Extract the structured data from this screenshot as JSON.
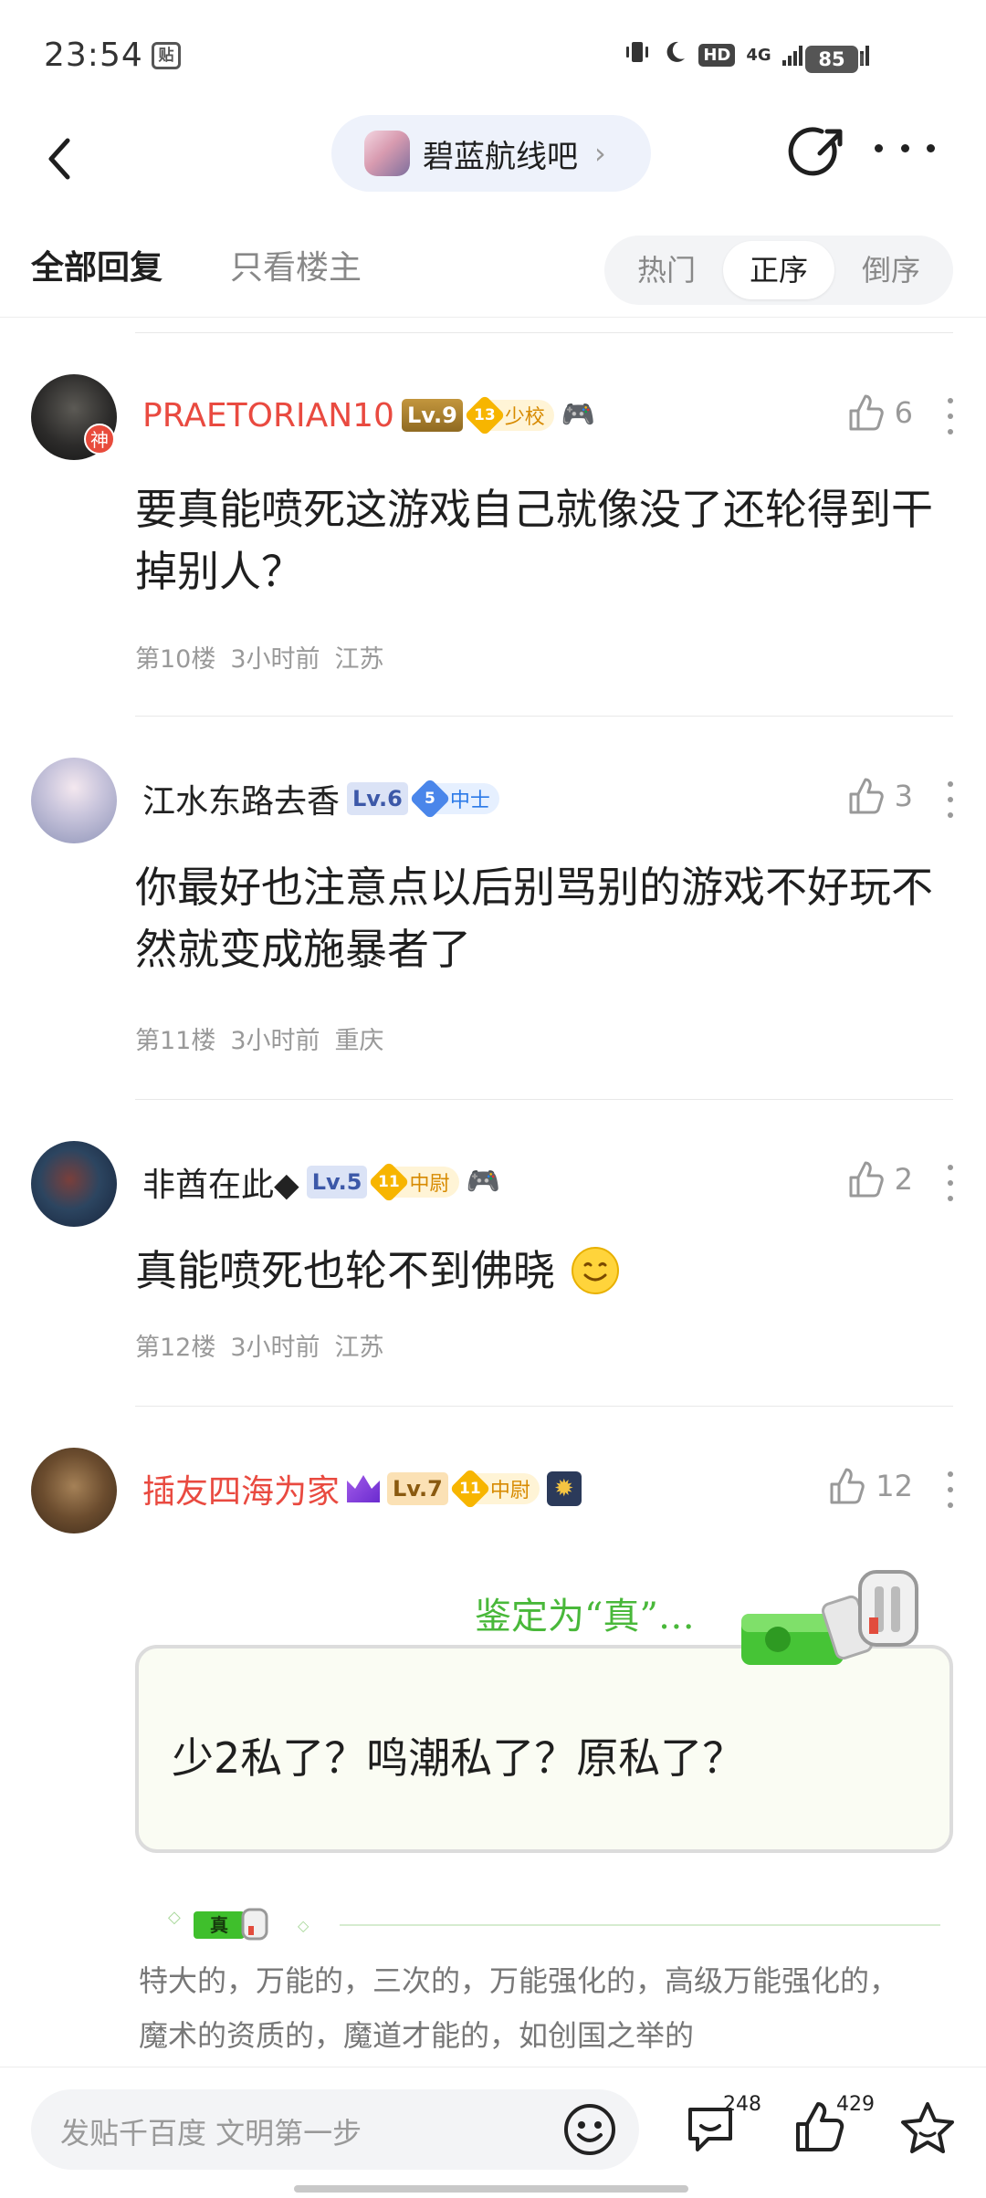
{
  "status_bar": {
    "time": "23:54",
    "app_badge": "贴",
    "hd": "HD",
    "net1": "4G",
    "net2": "4G",
    "battery": "85"
  },
  "header": {
    "forum_name": "碧蓝航线吧",
    "forum_chevron": "›"
  },
  "tabs": {
    "all": "全部回复",
    "lz": "只看楼主",
    "sort": {
      "hot": "热门",
      "asc": "正序",
      "desc": "倒序",
      "selected": "正序"
    }
  },
  "posts": [
    {
      "username": "PRAETORIAN10",
      "level": "Lv.9",
      "rank_num": "13",
      "rank_title": "少校",
      "god_badge": "神",
      "likes": "6",
      "content": "要真能喷死这游戏自己就像没了还轮得到干掉别人？",
      "floor": "第10楼",
      "time": "3小时前",
      "location": "江苏"
    },
    {
      "username": "江水东路去香",
      "level": "Lv.6",
      "rank_num": "5",
      "rank_title": "中士",
      "likes": "3",
      "content": "你最好也注意点以后别骂别的游戏不好玩不然就变成施暴者了",
      "floor": "第11楼",
      "time": "3小时前",
      "location": "重庆"
    },
    {
      "username": "非酋在此◆",
      "level": "Lv.5",
      "rank_num": "11",
      "rank_title": "中尉",
      "likes": "2",
      "content": "真能喷死也轮不到佛晓",
      "floor": "第12楼",
      "time": "3小时前",
      "location": "江苏"
    },
    {
      "username": "插友四海为家",
      "level": "Lv.7",
      "rank_num": "11",
      "rank_title": "中尉",
      "likes": "12"
    }
  ],
  "judgement": {
    "label": "鉴定为“真”…",
    "text": "少2私了？鸣潮私了？原私了？",
    "tag": "真",
    "detail": "特大的，万能的，三次的，万能强化的，高级万能强化的，魔术的资质的，魔道才能的，如创国之举的"
  },
  "bottom_bar": {
    "placeholder": "发贴千百度 文明第一步",
    "comment_count": "248",
    "like_count": "429"
  },
  "colors": {
    "accent_red": "#e94a40",
    "judge_green": "#49b83a",
    "muted": "#999999"
  }
}
